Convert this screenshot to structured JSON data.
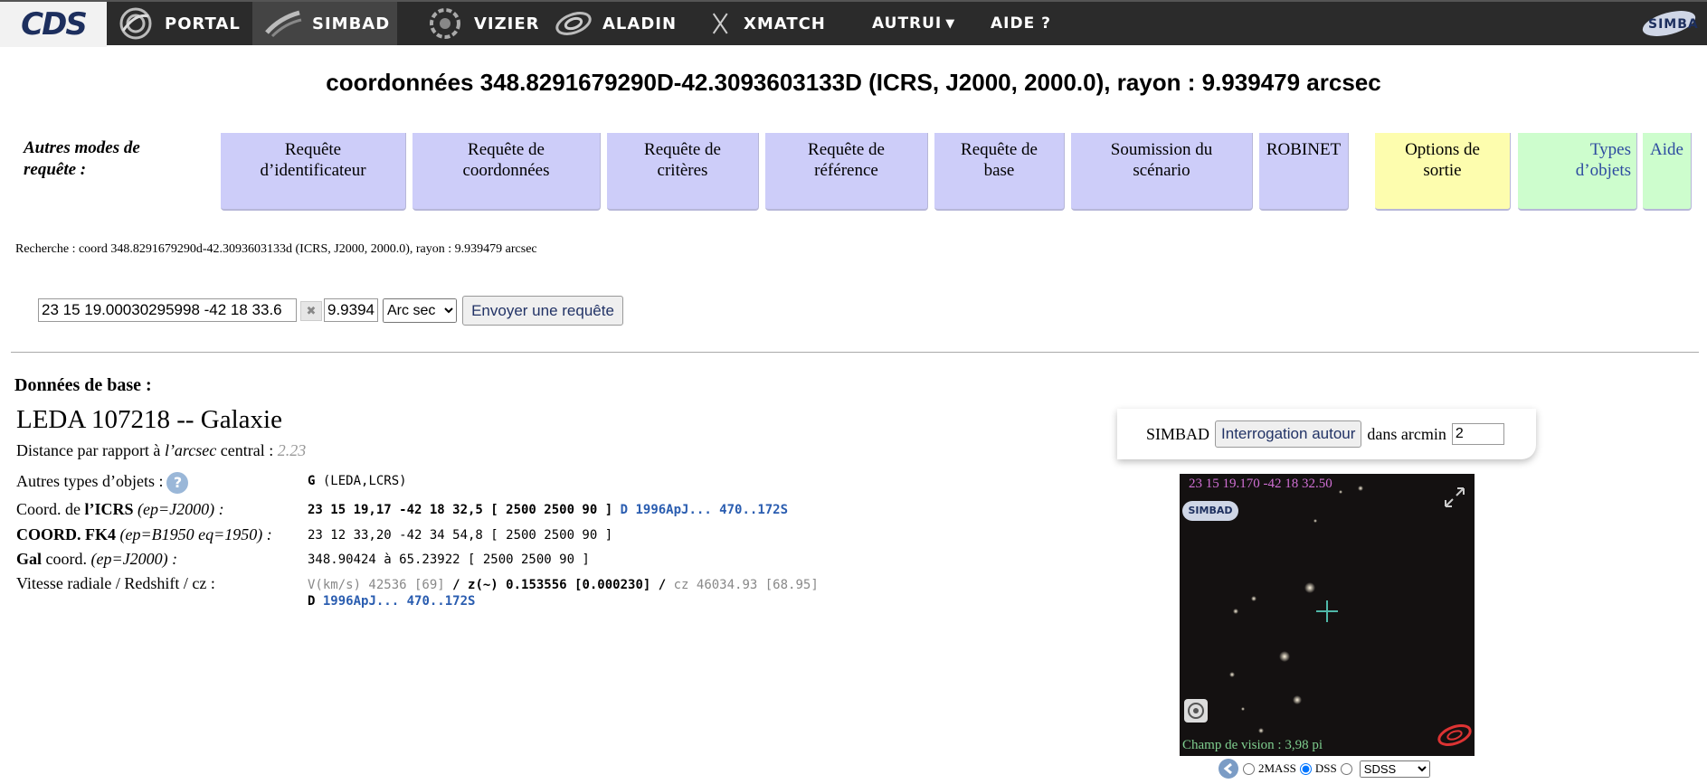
{
  "nav": {
    "logo": "CDS",
    "items": [
      {
        "id": "portal",
        "label": "Portal",
        "icon": "portal-icon"
      },
      {
        "id": "simbad",
        "label": "SIMBAD",
        "icon": "simbad-icon"
      },
      {
        "id": "vizier",
        "label": "VizieR",
        "icon": "vizier-icon"
      },
      {
        "id": "aladin",
        "label": "Aladin",
        "icon": "aladin-icon"
      },
      {
        "id": "xmatch",
        "label": "XMatch",
        "icon": "xmatch-icon"
      }
    ],
    "autrui": "Autrui",
    "aide": "Aide ?",
    "brand_logo": "SIMBAD"
  },
  "title": "coordonnées 348.8291679290D-42.3093603133D (ICRS, J2000, 2000.0), rayon : 9.939479 arcsec",
  "query_modes": {
    "label": "Autres modes de requête :",
    "modes": [
      {
        "label_line1": "Requête",
        "label_line2": "d’identificateur"
      },
      {
        "label_line1": "Requête de",
        "label_line2": "coordonnées"
      },
      {
        "label_line1": "Requête de",
        "label_line2": "critères"
      },
      {
        "label_line1": "Requête de",
        "label_line2": "référence"
      },
      {
        "label_line1": "Requête de",
        "label_line2": "base"
      },
      {
        "label_line1": "Soumission du",
        "label_line2": "scénario"
      },
      {
        "label_line1": "ROBINET",
        "label_line2": ""
      }
    ],
    "output_options_line1": "Options de",
    "output_options_line2": "sortie",
    "object_types_line1": "Types",
    "object_types_line2": "d’objets",
    "help": "Aide"
  },
  "search_summary": "Recherche : coord 348.8291679290d-42.3093603133d (ICRS, J2000, 2000.0), rayon : 9.939479 arcsec",
  "form": {
    "coord_value": "23 15 19.00030295998 -42 18 33.6",
    "clear_label": "✖",
    "radius_value": "9.9394",
    "unit_selected": "Arc sec",
    "submit_label": "Envoyer une requête"
  },
  "basic": {
    "heading": "Données de base :",
    "object_title": "LEDA 107218 -- Galaxie",
    "distance_prefix": "Distance par rapport à ",
    "distance_italic": "l’arcsec",
    "distance_suffix": " central : ",
    "distance_value": "2.23",
    "other_types_label": "Autres types d’objets :",
    "other_types_code": "G",
    "other_types_value": "(LEDA,LCRS)",
    "icrs_label_prefix": "Coord. de ",
    "icrs_label_bold": "l’ICRS",
    "icrs_label_italic": " (ep=J2000) :",
    "icrs_value": "23 15 19,17 -42 18 32,5 [ 2500 2500 90 ]",
    "icrs_ref_code": "D",
    "icrs_ref": "1996ApJ... 470..172S",
    "fk4_label_bold": "COORD. FK4",
    "fk4_label_italic": " (ep=B1950 eq=1950) :",
    "fk4_value": "23 12 33,20 -42 34 54,8 [ 2500 2500 90 ]",
    "gal_label_bold": "Gal",
    "gal_label_rest": " coord. ",
    "gal_label_italic": "(ep=J2000) :",
    "gal_value": "348.90424 à 65.23922 [ 2500 2500 90 ]",
    "rv_label": "Vitesse radiale / Redshift / cz :",
    "rv_v": "V(km/s) 42536 [69]",
    "rv_sep": " / ",
    "rv_z": "z(~) 0.153556 [0.000230]",
    "rv_cz": "cz 46034.93 [68.95]",
    "rv_ref_code": "D",
    "rv_ref": "1996ApJ... 470..172S"
  },
  "around": {
    "simbad_label": "SIMBAD",
    "button_label": "Interrogation autour",
    "dans_label": "dans arcmin",
    "arcmin_value": "2"
  },
  "sky": {
    "coord_label": "23 15 19.170 -42 18 32.50",
    "fov_label": "Champ de vision : 3,98 pi",
    "surveys": [
      "2MASS",
      "DSS"
    ],
    "selected_survey": "DSS",
    "select_value": "SDSS"
  }
}
